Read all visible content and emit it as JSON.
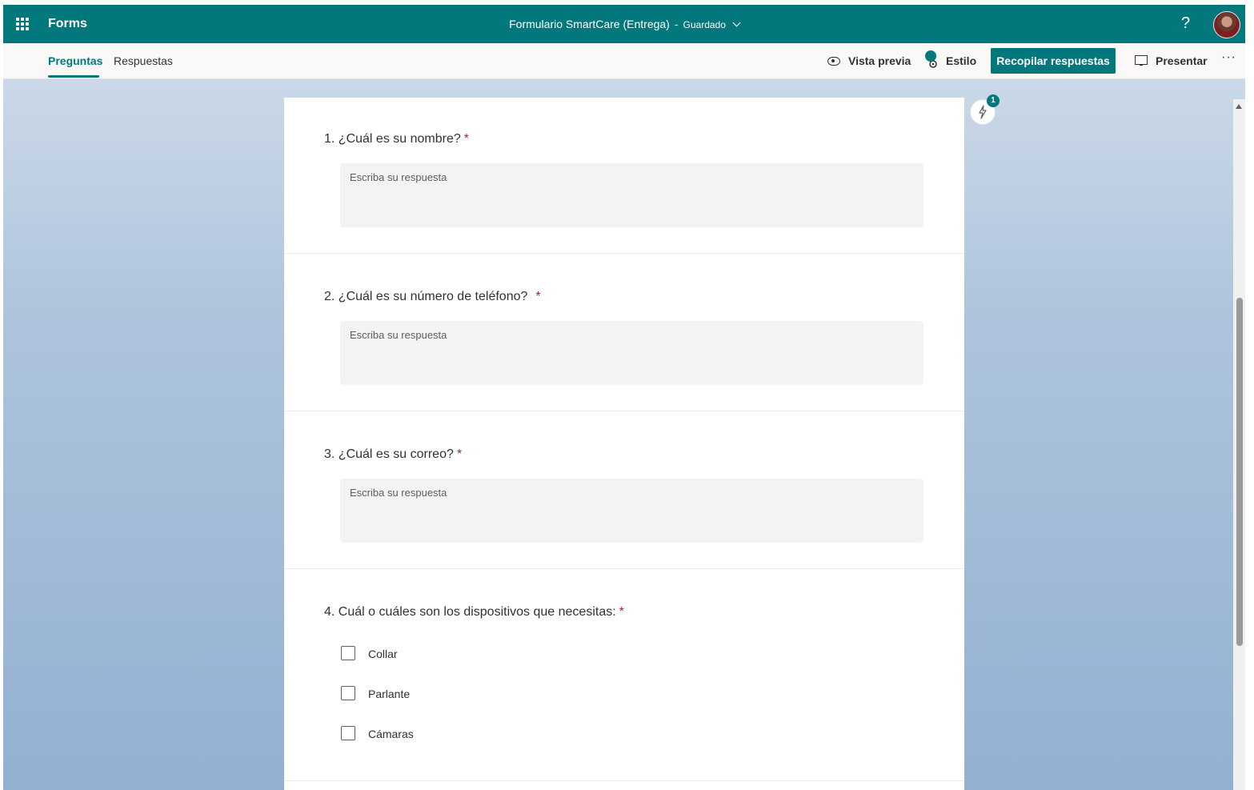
{
  "header": {
    "app_name": "Forms",
    "doc_title": "Formulario SmartCare (Entrega)",
    "separator": "-",
    "save_status": "Guardado",
    "help_glyph": "?"
  },
  "command_bar": {
    "tabs": [
      {
        "label": "Preguntas",
        "active": true
      },
      {
        "label": "Respuestas",
        "active": false
      }
    ],
    "preview_label": "Vista previa",
    "style_label": "Estilo",
    "collect_label": "Recopilar respuestas",
    "present_label": "Presentar",
    "more_glyph": "···"
  },
  "side": {
    "suggestions_badge": "1"
  },
  "questions": [
    {
      "number": "1.",
      "text": "¿Cuál es su nombre?",
      "required_mark": "*",
      "type": "text",
      "placeholder": "Escriba su respuesta"
    },
    {
      "number": "2.",
      "text": "¿Cuál es su número de teléfono?",
      "required_mark": "*",
      "type": "text",
      "placeholder": "Escriba su respuesta"
    },
    {
      "number": "3.",
      "text": "¿Cuál es su correo?",
      "required_mark": "*",
      "type": "text",
      "placeholder": "Escriba su respuesta"
    },
    {
      "number": "4.",
      "text": "Cuál o cuáles son los dispositivos que necesitas:",
      "required_mark": "*",
      "type": "checkbox",
      "options": [
        "Collar",
        "Parlante",
        "Cámaras"
      ]
    }
  ],
  "colors": {
    "accent": "#03787c",
    "required": "#a4262c"
  },
  "icons": {
    "app_launcher": "waffle-icon",
    "preview": "eye-icon",
    "style": "palette-icon",
    "present": "monitor-icon",
    "suggestions": "lightning-icon"
  }
}
